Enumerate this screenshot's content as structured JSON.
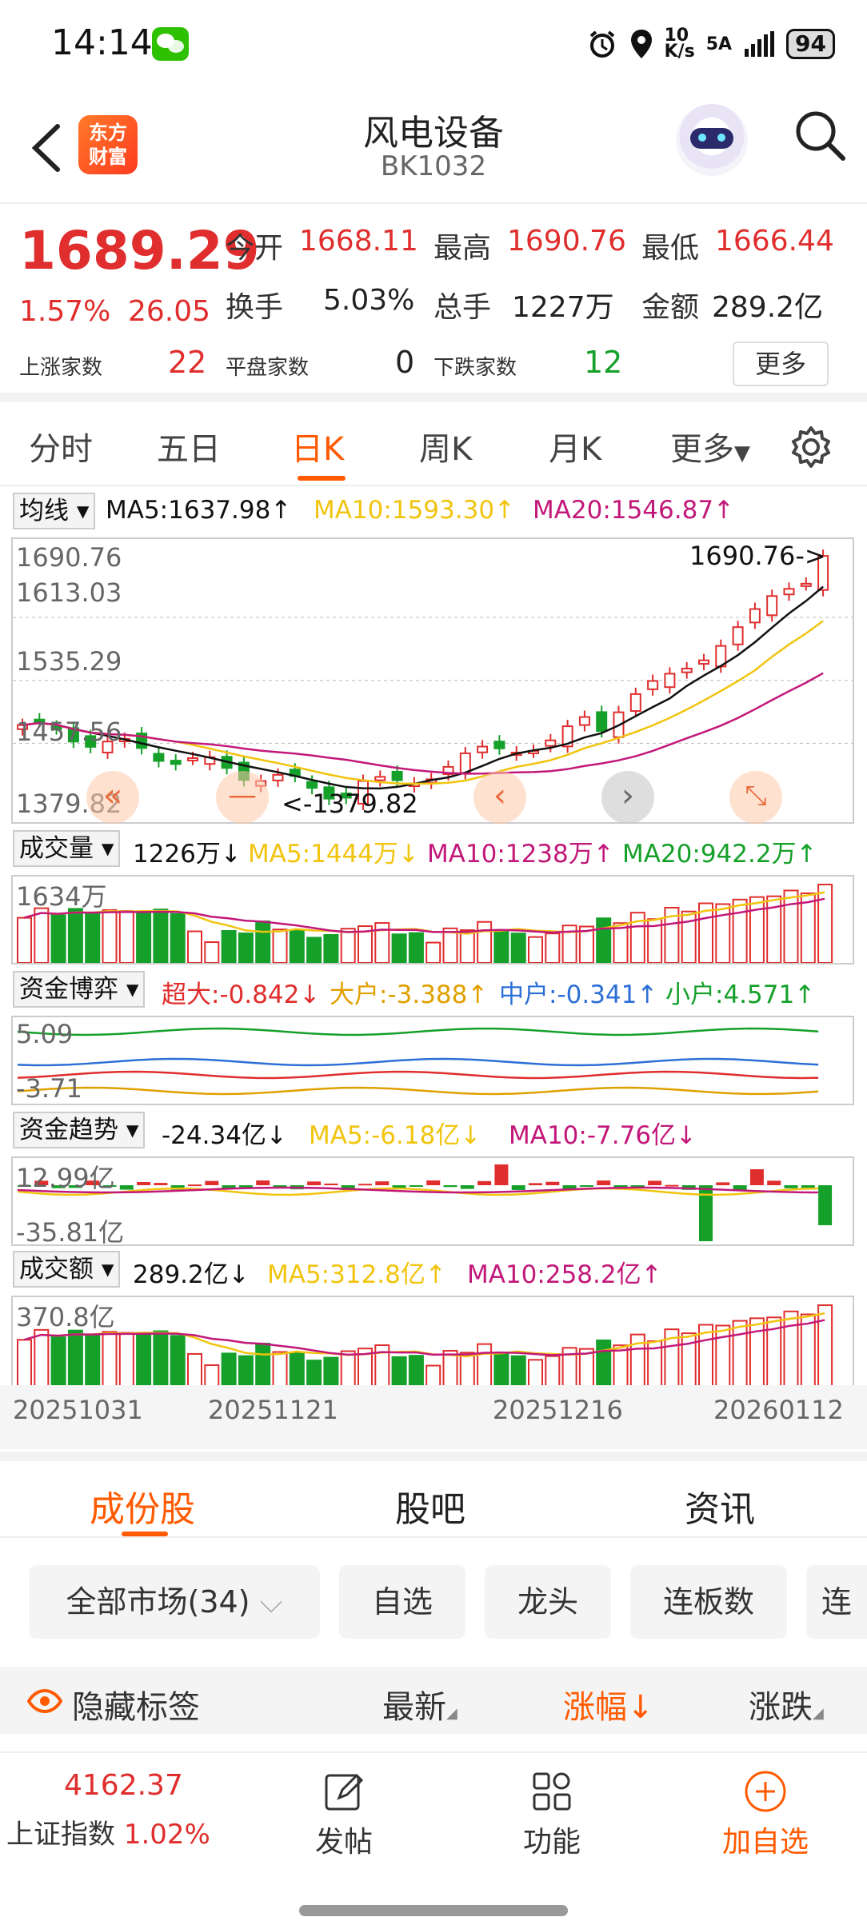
{
  "status": {
    "time": "14:14",
    "net_speed_top": "10",
    "net_speed_bottom": "K/s",
    "network": "5A",
    "battery": "94"
  },
  "header": {
    "logo_line1": "东方",
    "logo_line2": "财富",
    "title": "风电设备",
    "code": "BK1032"
  },
  "quote": {
    "price": "1689.29",
    "pct": "1.57%",
    "change": "26.05",
    "open_label": "今开",
    "open": "1668.11",
    "high_label": "最高",
    "high": "1690.76",
    "low_label": "最低",
    "low": "1666.44",
    "turnover_label": "换手",
    "turnover": "5.03%",
    "volume_label": "总手",
    "volume": "1227万",
    "amount_label": "金额",
    "amount": "289.2亿",
    "up_label": "上涨家数",
    "up": "22",
    "flat_label": "平盘家数",
    "flat": "0",
    "down_label": "下跌家数",
    "down": "12",
    "more": "更多"
  },
  "tabs": [
    "分时",
    "五日",
    "日K",
    "周K",
    "月K",
    "更多"
  ],
  "kline": {
    "selector": "均线",
    "ma5": "MA5:1637.98↑",
    "ma10": "MA10:1593.30↑",
    "ma20": "MA20:1546.87↑",
    "y_labels": [
      "1690.76",
      "1613.03",
      "1535.29",
      "1457.56",
      "1379.82"
    ],
    "high_marker": "1690.76->",
    "low_marker": "<-1379.82",
    "zoom_out": "—"
  },
  "volume": {
    "selector": "成交量",
    "value": "1226万↓",
    "ma5": "MA5:1444万↓",
    "ma10": "MA10:1238万↑",
    "ma20": "MA20:942.2万↑",
    "top_label": "1634万"
  },
  "fund_game": {
    "selector": "资金博弈",
    "super": "超大:-0.842↓",
    "large": "大户:-3.388↑",
    "mid": "中户:-0.341↑",
    "small": "小户:4.571↑",
    "top_label": "5.09",
    "bottom_label": "-3.71"
  },
  "fund_trend": {
    "selector": "资金趋势",
    "value": "-24.34亿↓",
    "ma5": "MA5:-6.18亿↓",
    "ma10": "MA10:-7.76亿↓",
    "top_label": "12.99亿",
    "bottom_label": "-35.81亿"
  },
  "amount": {
    "selector": "成交额",
    "value": "289.2亿↓",
    "ma5": "MA5:312.8亿↑",
    "ma10": "MA10:258.2亿↑",
    "top_label": "370.8亿"
  },
  "dates": [
    "20251031",
    "20251121",
    "20251216",
    "20260112"
  ],
  "bottom_tabs": [
    "成份股",
    "股吧",
    "资讯"
  ],
  "filters": [
    "全部市场(34)",
    "自选",
    "龙头",
    "连板数",
    "连"
  ],
  "sortbar": {
    "hide": "隐藏标签",
    "latest": "最新",
    "pct": "涨幅↓",
    "change": "涨跌"
  },
  "bottom_nav": {
    "index_value": "4162.37",
    "index_name": "上证指数",
    "index_pct": "1.02%",
    "post": "发帖",
    "func": "功能",
    "add": "加自选"
  },
  "colors": {
    "up": "#e02d2d",
    "down": "#15a02a",
    "accent": "#ff5a00",
    "ma5": "#111111",
    "ma10": "#f1c40f",
    "ma20": "#c2187a"
  }
}
